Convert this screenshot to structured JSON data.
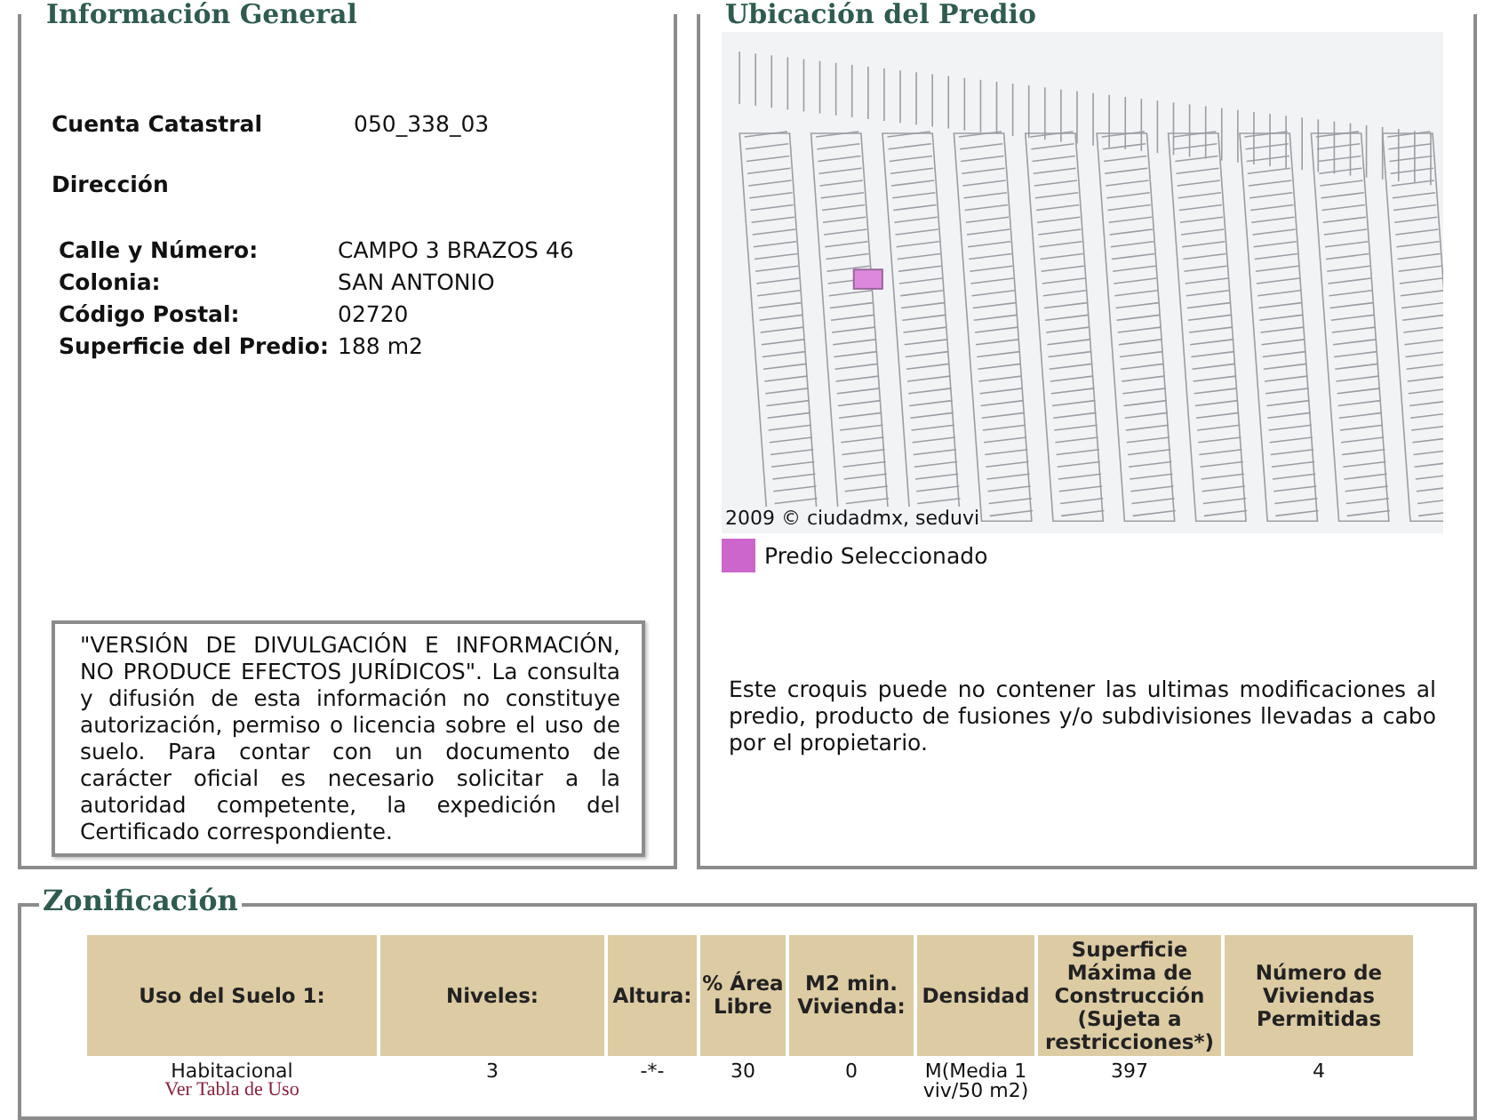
{
  "general": {
    "title": "Información General",
    "account": {
      "label": "Cuenta Catastral",
      "value": "050_338_03"
    },
    "address_heading": "Dirección",
    "fields": [
      {
        "label": "Calle y Número:",
        "value": "CAMPO 3 BRAZOS 46"
      },
      {
        "label": "Colonia:",
        "value": "SAN ANTONIO"
      },
      {
        "label": "Código Postal:",
        "value": "02720"
      },
      {
        "label": "Superficie del Predio:",
        "value": "188 m2"
      }
    ],
    "notice": "\"VERSIÓN DE DIVULGACIÓN E INFORMACIÓN, NO PRODUCE EFECTOS JURÍDICOS\". La consulta y difusión de esta información no constituye autorización, permiso o licencia sobre el uso de suelo. Para contar con un documento de carácter oficial es necesario solicitar a la autoridad competente, la expedición del Certificado correspondiente."
  },
  "location": {
    "title": "Ubicación del Predio",
    "map_credit": "2009 © ciudadmx, seduvi",
    "legend": {
      "label": "Predio Seleccionado",
      "color": "#cc66cc"
    },
    "note": "Este croquis puede no contener las ultimas modificaciones al predio, producto de fusiones y/o subdivisiones llevadas a cabo por el propietario."
  },
  "zoning": {
    "title": "Zonificación",
    "columns": [
      "Uso del Suelo 1:",
      "Niveles:",
      "Altura:",
      "% Área Libre",
      "M2 min. Vivienda:",
      "Densidad",
      "Superficie Máxima de Construcción (Sujeta a restricciones*)",
      "Número de Viviendas Permitidas"
    ],
    "rows": [
      {
        "cells": [
          "Habitacional",
          "3",
          "-*-",
          "30",
          "0",
          "M(Media 1 viv/50 m2)",
          "397",
          "4"
        ],
        "use_link": "Ver Tabla de Uso"
      }
    ]
  }
}
